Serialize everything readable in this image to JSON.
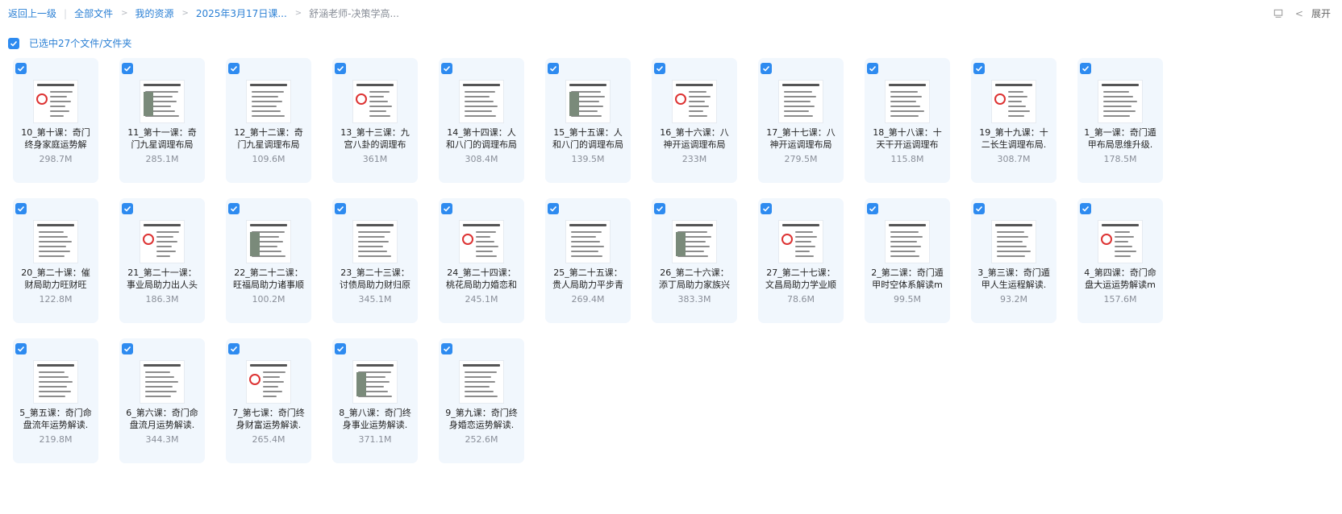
{
  "breadcrumb": {
    "back": "返回上一级",
    "items": [
      "全部文件",
      "我的资源",
      "2025年3月17日课..."
    ],
    "current": "舒涵老师-决策学高..."
  },
  "toolbar": {
    "expand_label": "展开"
  },
  "selection": {
    "label": "已选中27个文件/文件夹"
  },
  "colors": {
    "accent": "#2e8bf0",
    "link": "#2a7fd4",
    "card_bg": "#f1f7fd"
  },
  "files": [
    {
      "name": "10_第十课：奇门终身家庭运势解",
      "size": "298.7M"
    },
    {
      "name": "11_第十一课：奇门九星调理布局",
      "size": "285.1M"
    },
    {
      "name": "12_第十二课：奇门九星调理布局",
      "size": "109.6M"
    },
    {
      "name": "13_第十三课：九宫八卦的调理布",
      "size": "361M"
    },
    {
      "name": "14_第十四课：人和八门的调理布局",
      "size": "308.4M"
    },
    {
      "name": "15_第十五课：人和八门的调理布局",
      "size": "139.5M"
    },
    {
      "name": "16_第十六课：八神开运调理布局",
      "size": "233M"
    },
    {
      "name": "17_第十七课：八神开运调理布局",
      "size": "279.5M"
    },
    {
      "name": "18_第十八课：十天干开运调理布",
      "size": "115.8M"
    },
    {
      "name": "19_第十九课：十二长生调理布局.",
      "size": "308.7M"
    },
    {
      "name": "1_第一课：奇门遁甲布局思维升级.",
      "size": "178.5M"
    },
    {
      "name": "20_第二十课：催财局助力旺财旺",
      "size": "122.8M"
    },
    {
      "name": "21_第二十一课：事业局助力出人头",
      "size": "186.3M"
    },
    {
      "name": "22_第二十二课：旺福局助力诸事顺",
      "size": "100.2M"
    },
    {
      "name": "23_第二十三课：讨债局助力财归原",
      "size": "345.1M"
    },
    {
      "name": "24_第二十四课：桃花局助力婚恋和",
      "size": "245.1M"
    },
    {
      "name": "25_第二十五课：贵人局助力平步青",
      "size": "269.4M"
    },
    {
      "name": "26_第二十六课：添丁局助力家族兴",
      "size": "383.3M"
    },
    {
      "name": "27_第二十七课：文昌局助力学业顺",
      "size": "78.6M"
    },
    {
      "name": "2_第二课：奇门遁甲时空体系解读m",
      "size": "99.5M"
    },
    {
      "name": "3_第三课：奇门遁甲人生运程解读.",
      "size": "93.2M"
    },
    {
      "name": "4_第四课：奇门命盘大运运势解读m",
      "size": "157.6M"
    },
    {
      "name": "5_第五课：奇门命盘流年运势解读.",
      "size": "219.8M"
    },
    {
      "name": "6_第六课：奇门命盘流月运势解读.",
      "size": "344.3M"
    },
    {
      "name": "7_第七课：奇门终身财富运势解读.",
      "size": "265.4M"
    },
    {
      "name": "8_第八课：奇门终身事业运势解读.",
      "size": "371.1M"
    },
    {
      "name": "9_第九课：奇门终身婚恋运势解读.",
      "size": "252.6M"
    }
  ]
}
